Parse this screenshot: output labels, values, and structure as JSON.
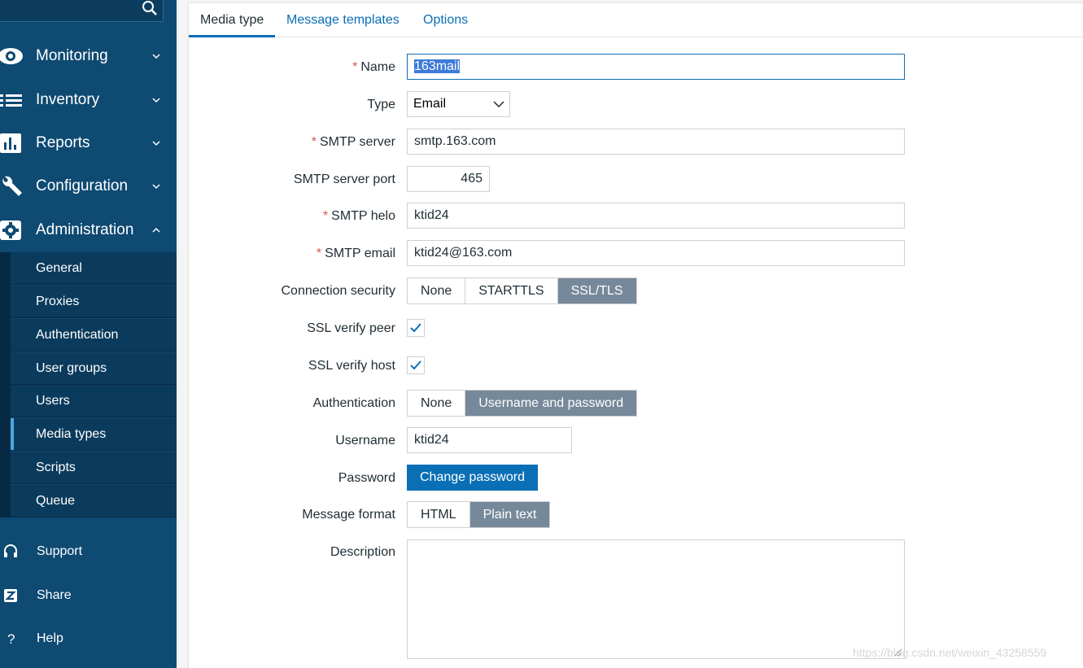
{
  "sidebar": {
    "nav": [
      {
        "label": "Monitoring",
        "icon": "eye-icon",
        "expanded": false
      },
      {
        "label": "Inventory",
        "icon": "list-icon",
        "expanded": false
      },
      {
        "label": "Reports",
        "icon": "bar-chart-icon",
        "expanded": false
      },
      {
        "label": "Configuration",
        "icon": "wrench-icon",
        "expanded": false
      },
      {
        "label": "Administration",
        "icon": "gear-icon",
        "expanded": true
      }
    ],
    "admin_items": [
      "General",
      "Proxies",
      "Authentication",
      "User groups",
      "Users",
      "Media types",
      "Scripts",
      "Queue"
    ],
    "active_item": "Media types",
    "bottom": [
      {
        "label": "Support",
        "icon": "headset-icon"
      },
      {
        "label": "Share",
        "icon": "share-z-icon"
      },
      {
        "label": "Help",
        "icon": "question-icon"
      }
    ]
  },
  "tabs": [
    "Media type",
    "Message templates",
    "Options"
  ],
  "active_tab": "Media type",
  "form": {
    "name_label": "Name",
    "name_value": "163mail",
    "type_label": "Type",
    "type_value": "Email",
    "smtp_server_label": "SMTP server",
    "smtp_server_value": "smtp.163.com",
    "smtp_port_label": "SMTP server port",
    "smtp_port_value": "465",
    "smtp_helo_label": "SMTP helo",
    "smtp_helo_value": "ktid24",
    "smtp_email_label": "SMTP email",
    "smtp_email_value": "ktid24@163.com",
    "conn_security_label": "Connection security",
    "conn_security_options": [
      "None",
      "STARTTLS",
      "SSL/TLS"
    ],
    "conn_security_selected": "SSL/TLS",
    "ssl_peer_label": "SSL verify peer",
    "ssl_peer_checked": true,
    "ssl_host_label": "SSL verify host",
    "ssl_host_checked": true,
    "auth_label": "Authentication",
    "auth_options": [
      "None",
      "Username and password"
    ],
    "auth_selected": "Username and password",
    "username_label": "Username",
    "username_value": "ktid24",
    "password_label": "Password",
    "change_password_label": "Change password",
    "msg_format_label": "Message format",
    "msg_format_options": [
      "HTML",
      "Plain text"
    ],
    "msg_format_selected": "Plain text",
    "description_label": "Description",
    "description_value": ""
  },
  "watermark": "https://blog.csdn.net/weixin_43258559",
  "colors": {
    "sidebar": "#0e4a72",
    "accent": "#0a6fb5",
    "segment_on": "#76899a",
    "required": "#d9534f"
  }
}
